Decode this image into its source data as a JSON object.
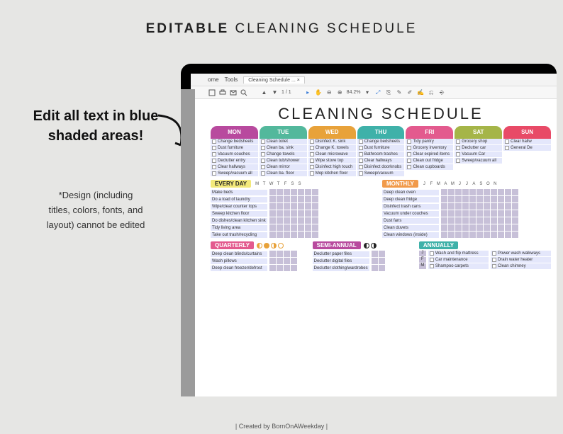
{
  "page": {
    "title_bold": "EDITABLE",
    "title_rest": "CLEANING SCHEDULE",
    "callout1_l1": "Edit all text in blue",
    "callout1_l2": "shaded areas!",
    "callout2_l1": "*Design (including",
    "callout2_l2": "titles, colors, fonts, and",
    "callout2_l3": "layout) cannot be edited",
    "credit": "| Created by BornOnAWeekday |"
  },
  "toolbar": {
    "home": "ome",
    "tools": "Tools",
    "tab": "Cleaning Schedule ...",
    "page_cur": "1",
    "page_sep": "/",
    "page_tot": "1",
    "zoom": "84.2%"
  },
  "doc": {
    "title": "CLEANING SCHEDULE",
    "days": [
      {
        "label": "MON",
        "cls": "c-mon",
        "tasks": [
          "Change bedsheets",
          "Dust furniture",
          "Vacuum couches",
          "Declutter entry",
          "Clear hallways",
          "Sweep/vacuum all"
        ]
      },
      {
        "label": "TUE",
        "cls": "c-tue",
        "tasks": [
          "Clean toilet",
          "Clean ba. sink",
          "Change towels",
          "Clean tub/shower",
          "Clean mirror",
          "Clean ba. floor"
        ]
      },
      {
        "label": "WED",
        "cls": "c-wed",
        "tasks": [
          "Disinfect K. sink",
          "Change K. towels",
          "Clean microwave",
          "Wipe stove top",
          "Disinfect high touch",
          "Mop kitchen floor"
        ]
      },
      {
        "label": "THU",
        "cls": "c-thu",
        "tasks": [
          "Change bedsheets",
          "Dust furniture",
          "Bathroom trashes",
          "Clear hallways",
          "Disinfect doorknobs",
          "Sweep/vacuum"
        ]
      },
      {
        "label": "FRI",
        "cls": "c-fri",
        "tasks": [
          "Tidy pantry",
          "Grocery inventory",
          "Clear expired items",
          "Clean out fridge",
          "Clean cupboards"
        ]
      },
      {
        "label": "SAT",
        "cls": "c-sat",
        "tasks": [
          "Grocery shop",
          "Declutter car",
          "Vacuum Car",
          "Sweep/vacuum all"
        ]
      },
      {
        "label": "SUN",
        "cls": "c-sun",
        "tasks": [
          "Clear hallw",
          "General De"
        ]
      }
    ],
    "everyday": {
      "title": "EVERY DAY",
      "labels": [
        "M",
        "T",
        "W",
        "T",
        "F",
        "S",
        "S"
      ],
      "items": [
        "Make beds",
        "Do a load of laundry",
        "Wipe/clear counter tops",
        "Sweep kitchen floor",
        "Do dishes/clean kitchen sink",
        "Tidy living area",
        "Take out trash/recycling"
      ]
    },
    "monthly": {
      "title": "MONTHLY",
      "labels": [
        "J",
        "F",
        "M",
        "A",
        "M",
        "J",
        "J",
        "A",
        "S",
        "O",
        "N"
      ],
      "items": [
        "Deep clean oven",
        "Deep clean fridge",
        "Disinfect trash cans",
        "Vacuum under couches",
        "Dust fans",
        "Clean duvets",
        "Clean windows (inside)"
      ]
    },
    "quarterly": {
      "title": "QUARTERLY",
      "items": [
        "Deep clean blinds/curtains",
        "Wash pillows",
        "Deep clean freezer/defrost"
      ]
    },
    "semi": {
      "title": "SEMI-ANNUAL",
      "items": [
        "Declutter paper files",
        "Declutter digital files",
        "Declutter clothing/wardrobes"
      ]
    },
    "annual": {
      "title": "ANNUALLY",
      "rows": [
        {
          "m": "J",
          "a": "Wash and flip mattress",
          "b": "Power wash walkways"
        },
        {
          "m": "F",
          "a": "Car maintenance",
          "b": "Drain water heater"
        },
        {
          "m": "M",
          "a": "Shampoo carpets",
          "b": "Clean chimney"
        }
      ]
    }
  }
}
